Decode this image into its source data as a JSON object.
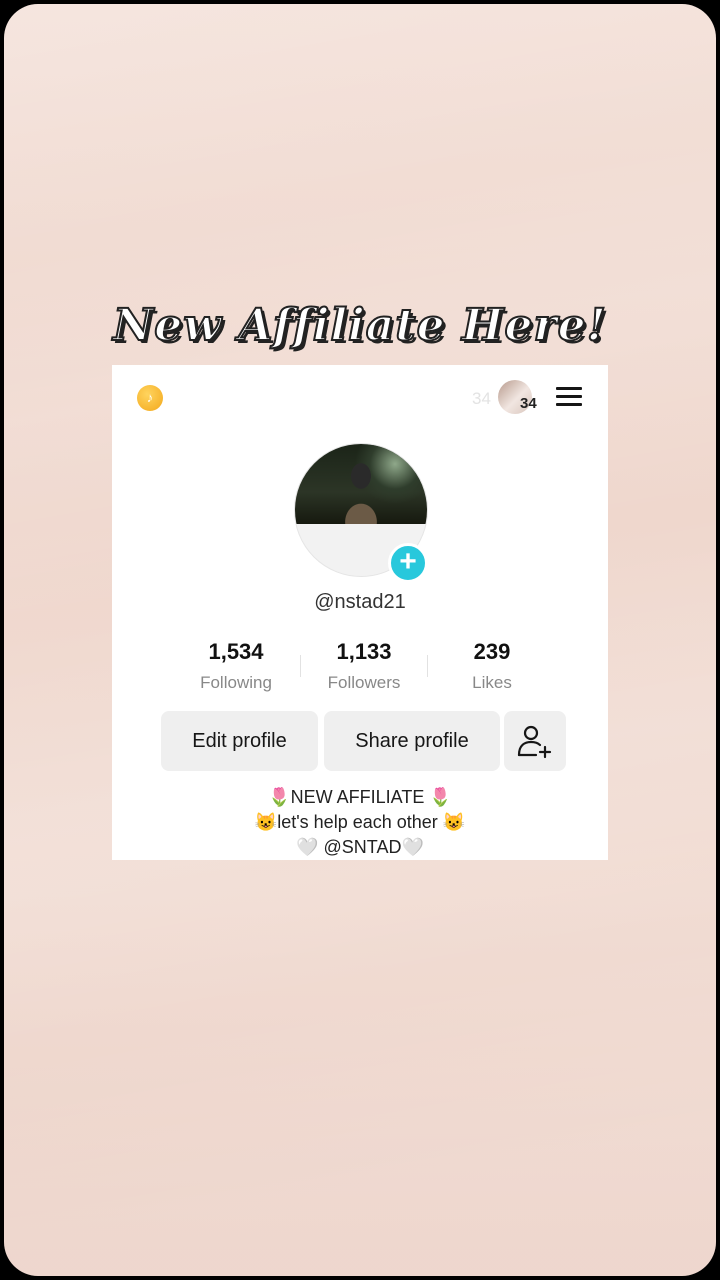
{
  "overlay": {
    "headline": "New Affiliate Here!"
  },
  "top_bar": {
    "ghost_count": "34",
    "notification_count": "34"
  },
  "profile": {
    "username": "@nstad21",
    "stats": [
      {
        "value": "1,534",
        "label": "Following"
      },
      {
        "value": "1,133",
        "label": "Followers"
      },
      {
        "value": "239",
        "label": "Likes"
      }
    ],
    "buttons": {
      "edit": "Edit profile",
      "share": "Share profile"
    },
    "bio": [
      "🌷NEW AFFILIATE 🌷",
      "😺let's  help each other 😺",
      "🤍 @SNTAD🤍"
    ]
  },
  "colors": {
    "accent": "#28c8dc",
    "coin": "#f3a81c",
    "background": "#f1dcd3"
  },
  "icons": [
    "tiktok-coin-icon",
    "menu-icon",
    "add-photo-plus-icon",
    "add-user-icon"
  ]
}
